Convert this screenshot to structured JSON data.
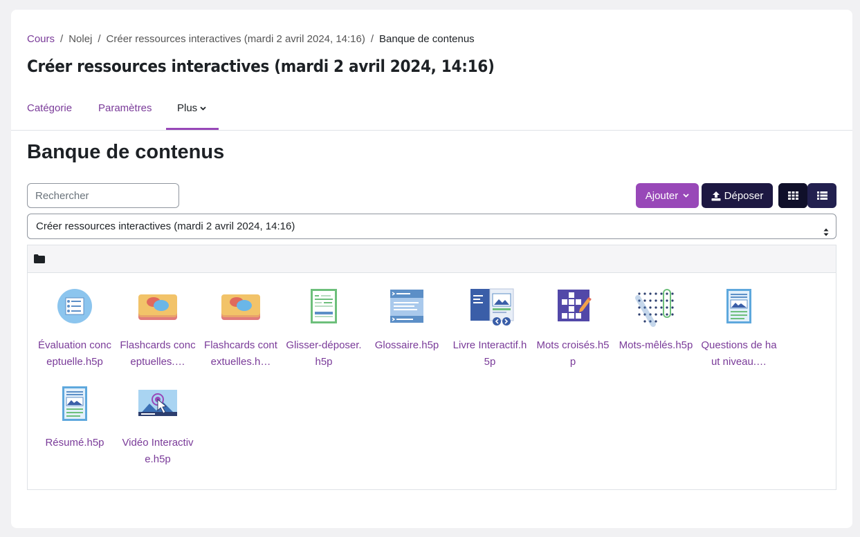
{
  "breadcrumb": {
    "items": [
      "Cours",
      "Nolej",
      "Créer ressources interactives (mardi 2 avril 2024, 14:16)",
      "Banque de contenus"
    ],
    "separator": "/"
  },
  "page_title": "Créer ressources interactives (mardi 2 avril 2024, 14:16)",
  "tabs": [
    {
      "label": "Catégorie",
      "active": false
    },
    {
      "label": "Paramètres",
      "active": false
    },
    {
      "label": "Plus",
      "active": true
    }
  ],
  "section_title": "Banque de contenus",
  "search": {
    "placeholder": "Rechercher",
    "value": ""
  },
  "buttons": {
    "add_label": "Ajouter",
    "upload_label": "Déposer",
    "grid_view_icon": "grid-icon",
    "list_view_icon": "list-icon"
  },
  "context_select": {
    "selected": "Créer ressources interactives (mardi 2 avril 2024, 14:16)"
  },
  "files": [
    {
      "name": "Évaluation conceptuelle.h5p",
      "display": "Évaluation conceptuelle.h5p",
      "icon": "assessment-icon"
    },
    {
      "name": "Flashcards conceptuelles.h5p",
      "display": "Flashcards conceptuelles.…",
      "icon": "flashcards-icon"
    },
    {
      "name": "Flashcards contextuelles.h5p",
      "display": "Flashcards contextuelles.h…",
      "icon": "flashcards-icon"
    },
    {
      "name": "Glisser-déposer.h5p",
      "display": "Glisser-déposer.h5p",
      "icon": "drag-drop-icon"
    },
    {
      "name": "Glossaire.h5p",
      "display": "Glossaire.h5p",
      "icon": "glossary-icon"
    },
    {
      "name": "Livre Interactif.h5p",
      "display": "Livre Interactif.h5p",
      "icon": "interactive-book-icon"
    },
    {
      "name": "Mots croisés.h5p",
      "display": "Mots croisés.h5p",
      "icon": "crossword-icon"
    },
    {
      "name": "Mots-mêlés.h5p",
      "display": "Mots-mêlés.h5p",
      "icon": "word-search-icon"
    },
    {
      "name": "Questions de haut niveau.h5p",
      "display": "Questions de haut niveau.…",
      "icon": "document-icon"
    },
    {
      "name": "Résumé.h5p",
      "display": "Résumé.h5p",
      "icon": "document-icon"
    },
    {
      "name": "Vidéo Interactive.h5p",
      "display": "Vidéo Interactive.h5p",
      "icon": "interactive-video-icon"
    }
  ],
  "colors": {
    "accent": "#9848b8",
    "link": "#7a3b99",
    "dark_button": "#1d1842"
  }
}
